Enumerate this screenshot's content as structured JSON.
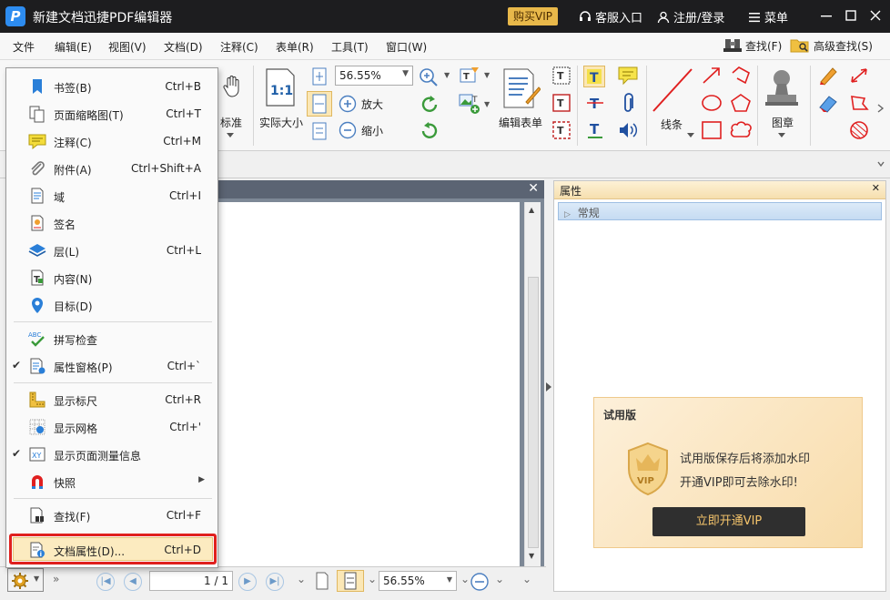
{
  "window": {
    "title": "新建文档迅捷PDF编辑器",
    "logo": "P",
    "vip": "购买VIP",
    "service": "客服入口",
    "login": "注册/登录",
    "menu": "菜单"
  },
  "menubar": {
    "items": [
      "文件",
      "编辑(E)",
      "视图(V)",
      "文档(D)",
      "注释(C)",
      "表单(R)",
      "工具(T)",
      "窗口(W)"
    ],
    "find": "查找(F)",
    "advanced_find": "高级查找(S)"
  },
  "ribbon": {
    "standard": "标准",
    "actual_size": "实际大小",
    "zoom_value": "56.55%",
    "zoom_in": "放大",
    "zoom_out": "缩小",
    "edit_form": "编辑表单",
    "lines": "线条",
    "stamp": "图章"
  },
  "properties": {
    "title": "属性",
    "section": "常规"
  },
  "trial": {
    "title": "试用版",
    "line1": "试用版保存后将添加水印",
    "line2": "开通VIP即可去除水印!",
    "button": "立即开通VIP",
    "badge": "VIP"
  },
  "statusbar": {
    "page": "1 / 1",
    "zoom": "56.55%"
  },
  "menu_items": [
    {
      "label": "书签(B)",
      "shortcut": "Ctrl+B",
      "icon": "bookmark-icon"
    },
    {
      "label": "页面缩略图(T)",
      "shortcut": "Ctrl+T",
      "icon": "thumbnails-icon"
    },
    {
      "label": "注释(C)",
      "shortcut": "Ctrl+M",
      "icon": "comment-icon"
    },
    {
      "label": "附件(A)",
      "shortcut": "Ctrl+Shift+A",
      "icon": "paperclip-icon"
    },
    {
      "label": "域",
      "shortcut": "Ctrl+I",
      "icon": "field-icon"
    },
    {
      "label": "签名",
      "shortcut": "",
      "icon": "signature-icon"
    },
    {
      "label": "层(L)",
      "shortcut": "Ctrl+L",
      "icon": "layers-icon"
    },
    {
      "label": "内容(N)",
      "shortcut": "",
      "icon": "content-icon"
    },
    {
      "label": "目标(D)",
      "shortcut": "",
      "icon": "destination-icon"
    },
    {
      "label": "拼写检查",
      "shortcut": "",
      "icon": "spellcheck-icon"
    },
    {
      "label": "属性窗格(P)",
      "shortcut": "Ctrl+`",
      "icon": "properties-pane-icon",
      "checked": true
    },
    {
      "label": "显示标尺",
      "shortcut": "Ctrl+R",
      "icon": "ruler-icon"
    },
    {
      "label": "显示网格",
      "shortcut": "Ctrl+'",
      "icon": "grid-icon"
    },
    {
      "label": "显示页面测量信息",
      "shortcut": "",
      "icon": "measure-icon",
      "checked": true
    },
    {
      "label": "快照",
      "shortcut": "",
      "icon": "magnet-icon",
      "submenu": true
    },
    {
      "label": "查找(F)",
      "shortcut": "Ctrl+F",
      "icon": "find-icon"
    },
    {
      "label": "文档属性(D)...",
      "shortcut": "Ctrl+D",
      "icon": "doc-properties-icon"
    }
  ]
}
